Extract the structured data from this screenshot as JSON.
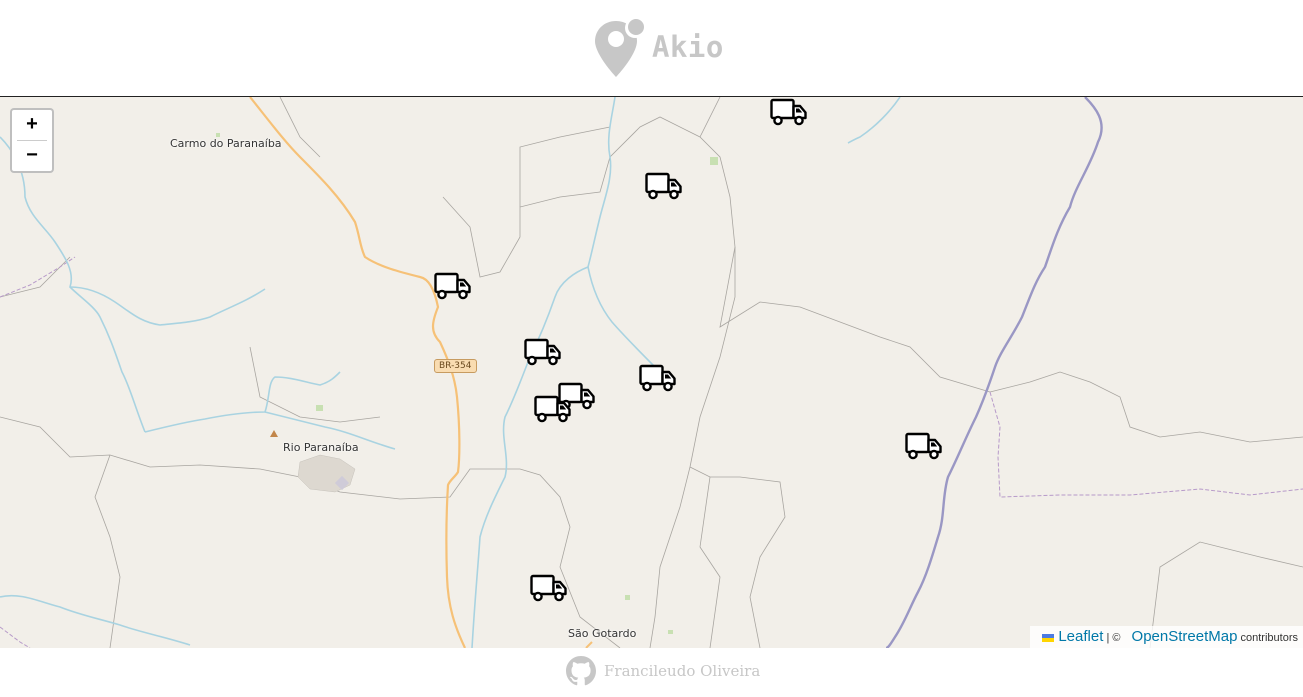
{
  "header": {
    "app_name": "Akio",
    "logo_icon": "map-pin-icon"
  },
  "map": {
    "zoom": {
      "in_label": "+",
      "out_label": "−"
    },
    "places": [
      {
        "name": "Carmo do Paranaíba"
      },
      {
        "name": "Rio Paranaíba"
      },
      {
        "name": "São Gotardo"
      }
    ],
    "road_shield": "BR-354",
    "markers": {
      "icon": "truck-icon",
      "count": 9
    },
    "attribution": {
      "leaflet_label": "Leaflet",
      "separator": "| ©",
      "osm_label": "OpenStreetMap",
      "suffix": "contributors"
    }
  },
  "footer": {
    "author": "Francileudo Oliveira",
    "icon": "github-icon"
  }
}
